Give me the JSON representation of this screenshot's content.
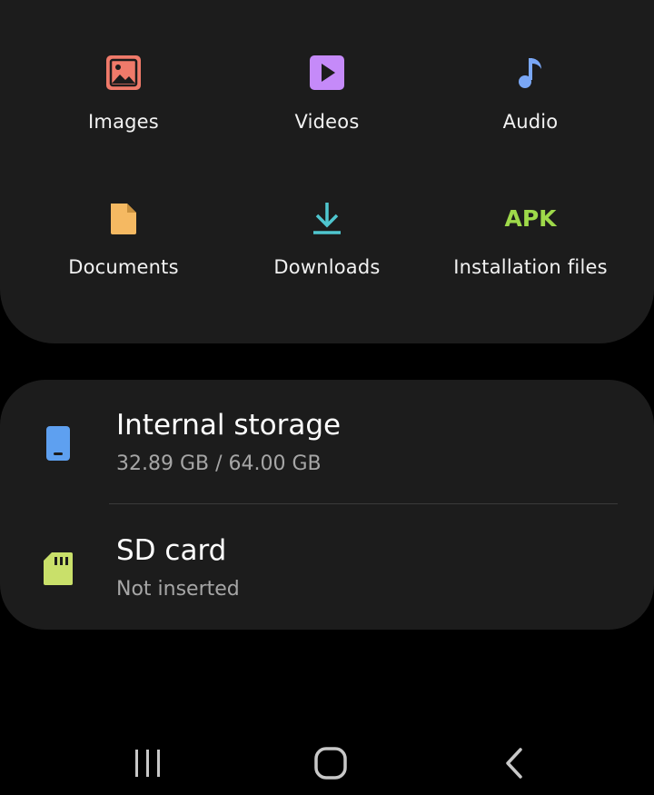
{
  "categories": [
    {
      "label": "Images",
      "icon": "image-icon",
      "color": "#f07a6a"
    },
    {
      "label": "Videos",
      "icon": "video-icon",
      "color": "#c58af9"
    },
    {
      "label": "Audio",
      "icon": "music-note-icon",
      "color": "#7aa7f5"
    },
    {
      "label": "Documents",
      "icon": "document-icon",
      "color": "#f5b962"
    },
    {
      "label": "Downloads",
      "icon": "download-icon",
      "color": "#4fc6cf"
    },
    {
      "label": "Installation files",
      "icon": "apk-icon",
      "icon_text": "APK",
      "color": "#9ed94a"
    }
  ],
  "storage": [
    {
      "title": "Internal storage",
      "subtitle": "32.89 GB / 64.00 GB",
      "icon": "phone-icon",
      "color": "#5ea0f0"
    },
    {
      "title": "SD card",
      "subtitle": "Not inserted",
      "icon": "sd-card-icon",
      "color": "#c9e06a"
    }
  ],
  "navbar": {
    "recents": "recents-icon",
    "home": "home-icon",
    "back": "back-icon",
    "color": "#c8c8c8"
  }
}
